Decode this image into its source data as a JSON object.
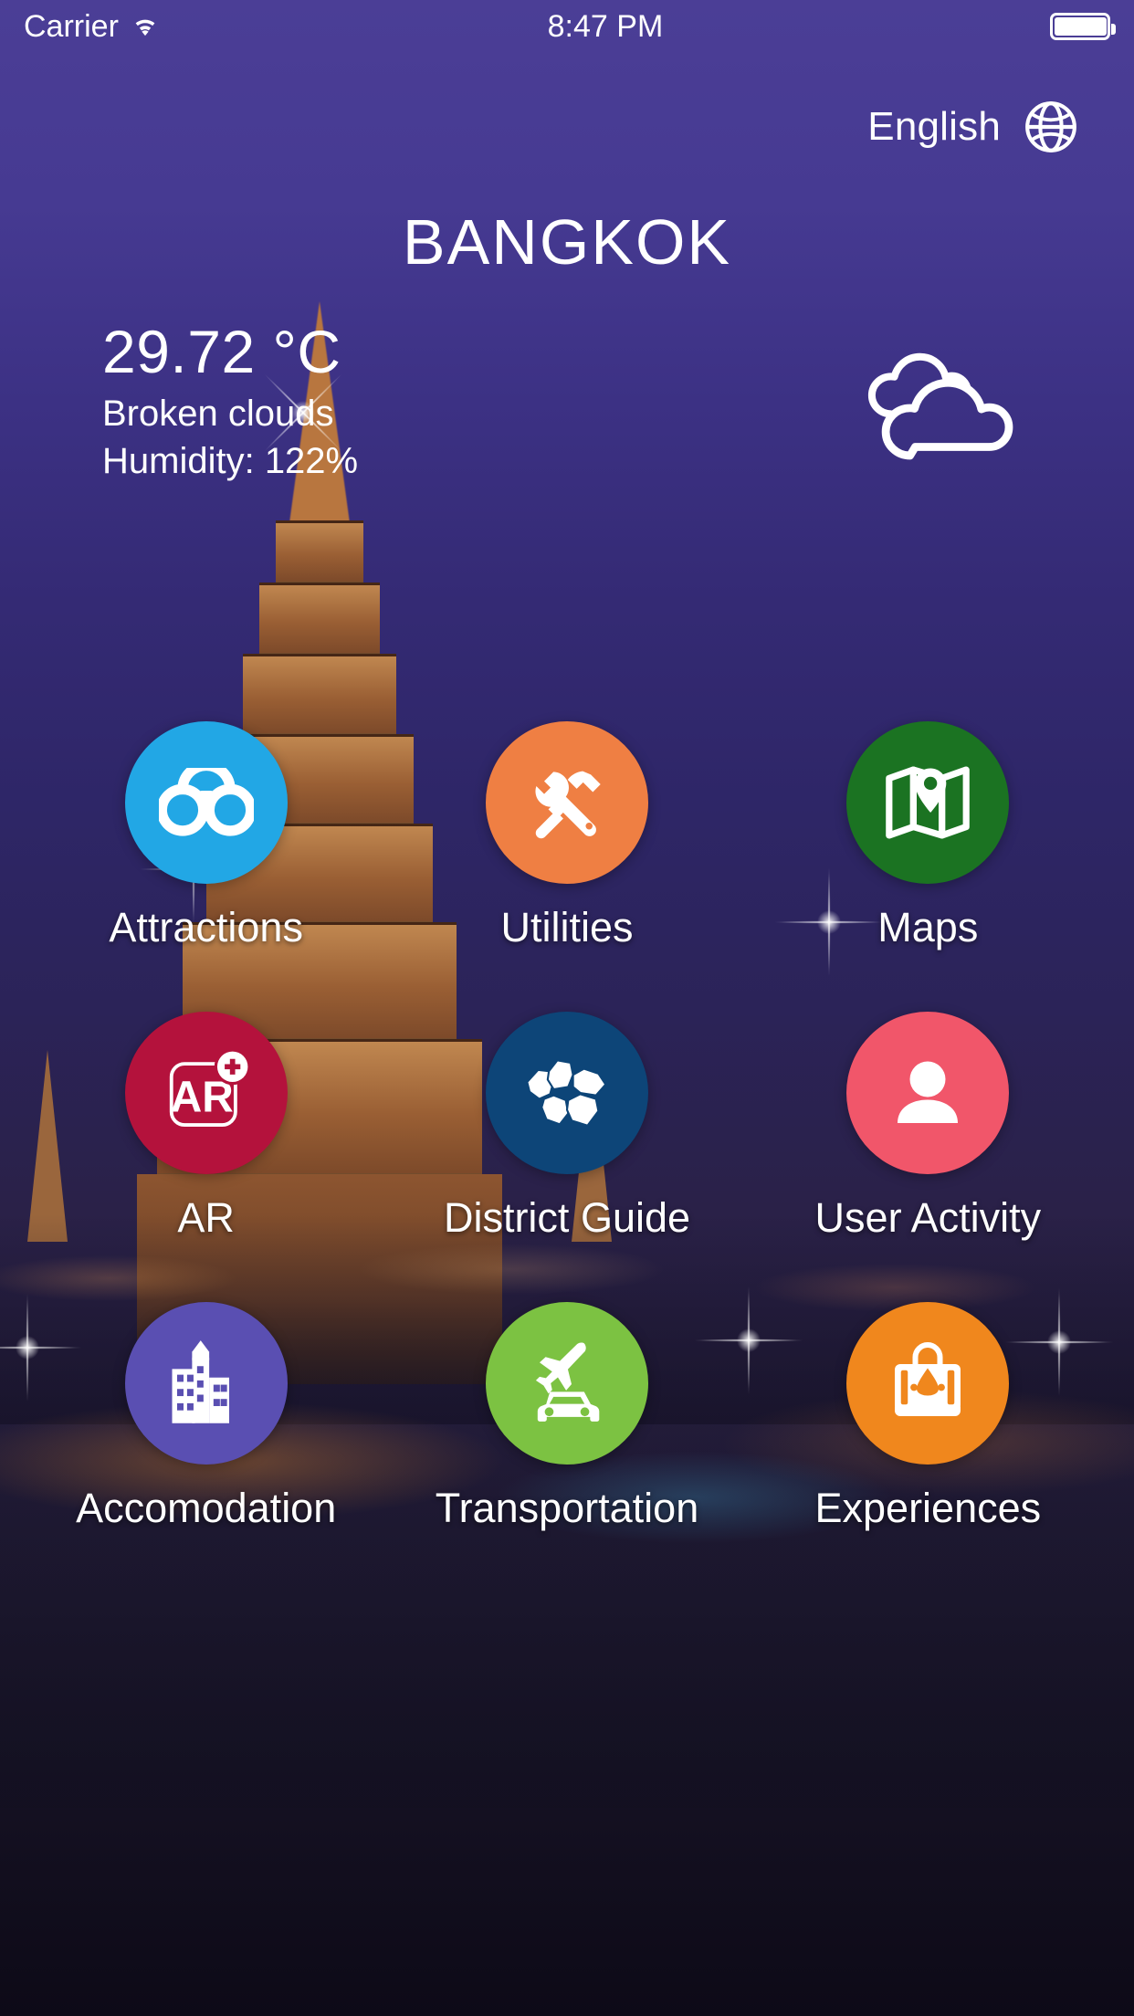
{
  "status_bar": {
    "carrier": "Carrier",
    "wifi_icon": "wifi-icon",
    "time": "8:47 PM",
    "battery_icon": "battery-icon"
  },
  "language_selector": {
    "label": "English",
    "icon": "globe-icon"
  },
  "header": {
    "city": "BANGKOK"
  },
  "weather": {
    "temperature": "29.72 °C",
    "condition": "Broken clouds",
    "humidity": "Humidity: 122%",
    "icon": "broken-clouds-icon"
  },
  "menu": {
    "tiles": [
      {
        "label": "Attractions",
        "icon": "binoculars-icon",
        "color": "#22a7e5"
      },
      {
        "label": "Utilities",
        "icon": "tools-icon",
        "color": "#ef7f43"
      },
      {
        "label": "Maps",
        "icon": "map-pin-icon",
        "color": "#1b7322"
      },
      {
        "label": "AR",
        "icon": "ar-plus-icon",
        "color": "#b4123c"
      },
      {
        "label": "District Guide",
        "icon": "districts-icon",
        "color": "#0d4578"
      },
      {
        "label": "User Activity",
        "icon": "person-icon",
        "color": "#f1566a"
      },
      {
        "label": "Accomodation",
        "icon": "buildings-icon",
        "color": "#5a4fb2"
      },
      {
        "label": "Transportation",
        "icon": "plane-car-icon",
        "color": "#7cc242"
      },
      {
        "label": "Experiences",
        "icon": "suitcase-icon",
        "color": "#f0871d"
      }
    ]
  }
}
